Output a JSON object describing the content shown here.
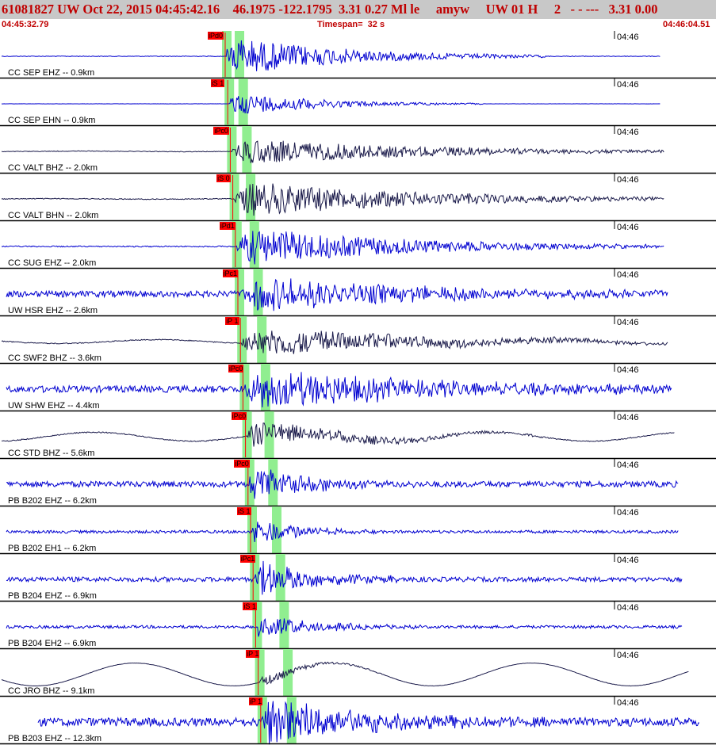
{
  "header": {
    "title": "61081827 UW Oct 22, 2015 04:45:42.16    46.1975 -122.1795  3.31 0.27 Ml le     amyw     UW 01 H     2   - - ---   3.31 0.00",
    "start_time": "04:45:32.79",
    "timespan": "Timespan=  32 s",
    "end_time": "04:46:04.51"
  },
  "tick_label": "04:46",
  "colors": {
    "header_bg": "#c8c8c8",
    "header_text": "#c00000",
    "blue_trace": "#0000d0",
    "dark_trace": "#1a1a4a",
    "pick_window": "#90ee90",
    "pick_flag": "#ff0000",
    "separator": "#000000"
  },
  "traces": [
    {
      "label": "CC SEP EHZ -- 0.9km",
      "pick": "iPd0",
      "color": "blue",
      "onset": 0.325,
      "dur": 0.38,
      "noise": 0.02,
      "amp": 0.95,
      "wave": 0,
      "end": 0.945
    },
    {
      "label": "CC SEP EHN -- 0.9km",
      "pick": "iS 1",
      "color": "blue",
      "onset": 0.33,
      "dur": 0.3,
      "noise": 0.01,
      "amp": 0.55,
      "wave": 0,
      "end": 0.945
    },
    {
      "label": "CC VALT BHZ -- 2.0km",
      "pick": "iPc0",
      "color": "dark",
      "onset": 0.32,
      "dur": 0.6,
      "noise": 0.03,
      "amp": 0.65,
      "wave": 0.02,
      "end": 0.95
    },
    {
      "label": "CC VALT BHN -- 2.0km",
      "pick": "iS 0",
      "color": "dark",
      "onset": 0.34,
      "dur": 0.6,
      "noise": 0.03,
      "amp": 0.85,
      "wave": 0.02,
      "end": 0.95
    },
    {
      "label": "CC SUG EHZ -- 2.0km",
      "pick": "iPd1",
      "color": "blue",
      "onset": 0.33,
      "dur": 0.55,
      "noise": 0.04,
      "amp": 0.9,
      "wave": 0,
      "end": 0.95
    },
    {
      "label": "UW HSR EHZ -- 2.6km",
      "pick": "iPc1",
      "color": "blue",
      "onset": 0.33,
      "dur": 0.6,
      "noise": 0.22,
      "amp": 0.8,
      "wave": 0,
      "end": 0.955
    },
    {
      "label": "CC SWF2 BHZ -- 3.6km",
      "pick": "iP 1",
      "color": "dark",
      "onset": 0.33,
      "dur": 0.6,
      "noise": 0.04,
      "amp": 0.7,
      "wave": 0.15,
      "end": 0.955
    },
    {
      "label": "UW SHW EHZ -- 4.4km",
      "pick": "iPc0",
      "color": "blue",
      "onset": 0.34,
      "dur": 0.6,
      "noise": 0.2,
      "amp": 0.95,
      "wave": 0,
      "end": 0.96
    },
    {
      "label": "CC STD BHZ -- 5.6km",
      "pick": "iPc0",
      "color": "dark",
      "onset": 0.34,
      "dur": 0.35,
      "noise": 0.05,
      "amp": 0.6,
      "wave": 0.35,
      "end": 0.965
    },
    {
      "label": "PB B202 EHZ -- 6.2km",
      "pick": "iPc0",
      "color": "blue",
      "onset": 0.345,
      "dur": 0.2,
      "noise": 0.2,
      "amp": 0.85,
      "wave": 0,
      "end": 0.97
    },
    {
      "label": "PB B202 EH1 -- 6.2km",
      "pick": "iS 1",
      "color": "blue",
      "onset": 0.375,
      "dur": 0.15,
      "noise": 0.12,
      "amp": 0.7,
      "wave": 0,
      "end": 0.97
    },
    {
      "label": "PB B204 EHZ -- 6.9km",
      "pick": "iPc1",
      "color": "blue",
      "onset": 0.35,
      "dur": 0.2,
      "noise": 0.15,
      "amp": 0.9,
      "wave": 0,
      "end": 0.975
    },
    {
      "label": "PB B204 EH2 -- 6.9km",
      "pick": "iS 1",
      "color": "blue",
      "onset": 0.355,
      "dur": 0.2,
      "noise": 0.15,
      "amp": 0.55,
      "wave": 0,
      "end": 0.975
    },
    {
      "label": "CC JRO BHZ -- 9.1km",
      "pick": "iP 1",
      "color": "dark",
      "onset": 0.36,
      "dur": 0.15,
      "noise": 0.03,
      "amp": 0.3,
      "wave": 0.9,
      "end": 0.985
    },
    {
      "label": "PB B203 EHZ -- 12.3km",
      "pick": "iP 1",
      "color": "blue",
      "onset": 0.38,
      "dur": 0.35,
      "noise": 0.2,
      "amp": 1.2,
      "wave": 0,
      "end": 1.0
    }
  ]
}
